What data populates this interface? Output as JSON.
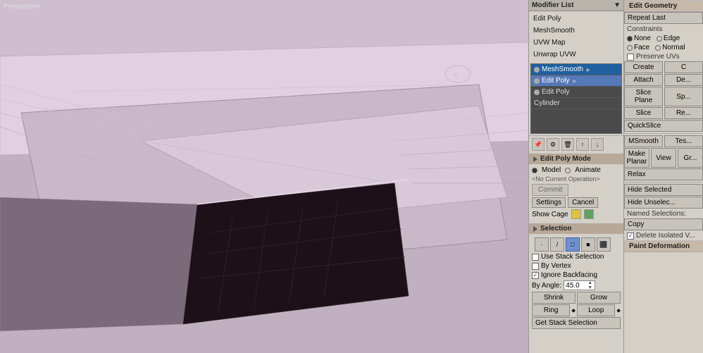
{
  "viewport": {
    "title": "Perspective"
  },
  "modifier_panel": {
    "title": "Modifier List",
    "close_btn": "×",
    "quick_btns": [
      "Edit Poly",
      "MeshSmooth",
      "UVW Map",
      "Unwrap UVW"
    ],
    "stack": [
      {
        "label": "MeshSmooth",
        "eye": true,
        "arrow": true,
        "selected": false
      },
      {
        "label": "Edit Poly",
        "eye": true,
        "arrow": true,
        "selected": true
      },
      {
        "label": "Edit Poly",
        "eye": true,
        "arrow": false,
        "selected": false
      },
      {
        "label": "Cylinder",
        "eye": false,
        "arrow": false,
        "selected": false
      }
    ]
  },
  "edit_poly_mode": {
    "title": "Edit Poly Mode",
    "model_label": "Model",
    "animate_label": "Animate",
    "operation_label": "<No Current Operation>",
    "commit_label": "Commit",
    "settings_label": "Settings",
    "cancel_label": "Cancel",
    "show_cage_label": "Show Cage"
  },
  "selection": {
    "title": "Selection",
    "use_stack_label": "Use Stack Selection",
    "by_vertex_label": "By Vertex",
    "ignore_backfacing_label": "Ignore Backfacing",
    "by_angle_label": "By Angle:",
    "by_angle_val": "45.0",
    "shrink_label": "Shrink",
    "grow_label": "Grow",
    "ring_label": "Ring",
    "loop_label": "Loop",
    "get_stack_label": "Get Stack Selection"
  },
  "edit_geometry": {
    "title": "Edit Geometry",
    "repeat_last_label": "Repeat Last",
    "constraints_label": "Constraints",
    "none_label": "None",
    "edge_label": "Edge",
    "face_label": "Face",
    "normal_label": "Normal",
    "preserve_uvs_label": "Preserve UVs",
    "create_label": "Create",
    "collapse_label": "C",
    "attach_label": "Attach",
    "detach_label": "De...",
    "slice_plane_label": "Slice Plane",
    "split_label": "Sp...",
    "slice_label": "Slice",
    "reset_plane_label": "Re...",
    "quickslice_label": "QuickSlice",
    "msmooth_label": "MSmooth",
    "tessellate_label": "Tes...",
    "make_planar_label": "Make Planar",
    "view_label": "View",
    "align_label": "Gr...",
    "relax_label": "Relax",
    "hide_selected_label": "Hide Selected",
    "hide_unselected_label": "Hide Unselec...",
    "named_selections_label": "Named Selections:",
    "copy_label": "Copy",
    "delete_isolated_label": "Delete Isolated V...",
    "paint_deformation_label": "Paint Deformation"
  }
}
